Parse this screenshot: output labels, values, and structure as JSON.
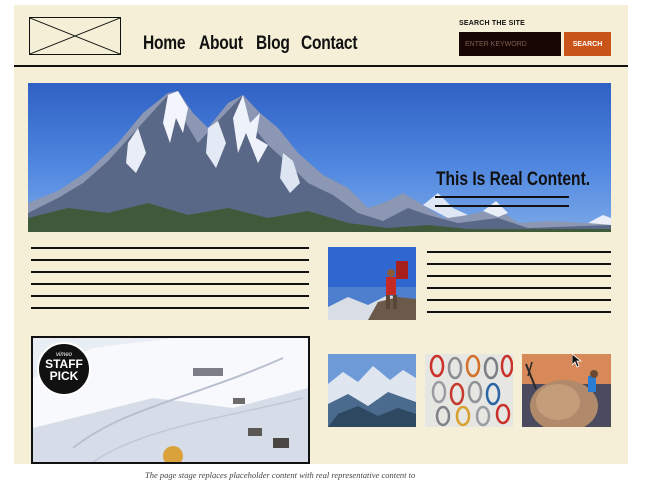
{
  "nav": {
    "items": [
      {
        "label": "Home"
      },
      {
        "label": "About"
      },
      {
        "label": "Blog"
      },
      {
        "label": "Contact"
      }
    ]
  },
  "search": {
    "label": "SEARCH THE SITE",
    "placeholder": "ENTER KEYWORD",
    "button_label": "SEARCH"
  },
  "hero": {
    "title": "This Is Real Content."
  },
  "video": {
    "badge_top": "vimeo",
    "badge_line1": "STAFF",
    "badge_line2": "PICK"
  },
  "caption": "The page stage replaces placeholder content with real representative content to",
  "colors": {
    "page_bg": "#f4efd6",
    "search_bg": "#180604",
    "search_button": "#c8541a",
    "ink": "#111111"
  },
  "icons": {
    "logo": "image-placeholder-icon",
    "cursor": "mouse-cursor-icon"
  }
}
